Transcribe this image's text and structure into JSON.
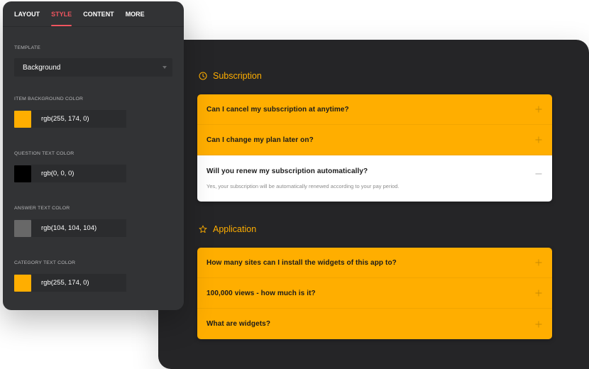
{
  "settings": {
    "tabs": [
      {
        "label": "LAYOUT",
        "active": false
      },
      {
        "label": "STYLE",
        "active": true
      },
      {
        "label": "CONTENT",
        "active": false
      },
      {
        "label": "MORE",
        "active": false
      }
    ],
    "template": {
      "label": "TEMPLATE",
      "value": "Background"
    },
    "colors": [
      {
        "label": "ITEM BACKGROUND COLOR",
        "value": "rgb(255, 174, 0)",
        "swatch": "#ffae00"
      },
      {
        "label": "QUESTION TEXT COLOR",
        "value": "rgb(0, 0, 0)",
        "swatch": "#000000"
      },
      {
        "label": "ANSWER TEXT COLOR",
        "value": "rgb(104, 104, 104)",
        "swatch": "#686868"
      },
      {
        "label": "CATEGORY TEXT COLOR",
        "value": "rgb(255, 174, 0)",
        "swatch": "#ffae00"
      }
    ],
    "accent_color": "#f0555f"
  },
  "faq": {
    "categories": [
      {
        "title": "Subscription",
        "icon": "clock-icon",
        "items": [
          {
            "question": "Can I cancel my subscription at anytime?",
            "expanded": false
          },
          {
            "question": "Can I change my plan later on?",
            "expanded": false
          },
          {
            "question": "Will you renew my subscription automatically?",
            "expanded": true,
            "answer": "Yes, your subscription will be automatically renewed according to your pay period."
          }
        ]
      },
      {
        "title": "Application",
        "icon": "star-icon",
        "items": [
          {
            "question": "How many sites can I install the widgets of this app to?",
            "expanded": false
          },
          {
            "question": "100,000 views - how much is it?",
            "expanded": false
          },
          {
            "question": "What are widgets?",
            "expanded": false
          }
        ]
      }
    ],
    "item_bg_color": "#ffae00",
    "category_color": "#ffae00"
  }
}
